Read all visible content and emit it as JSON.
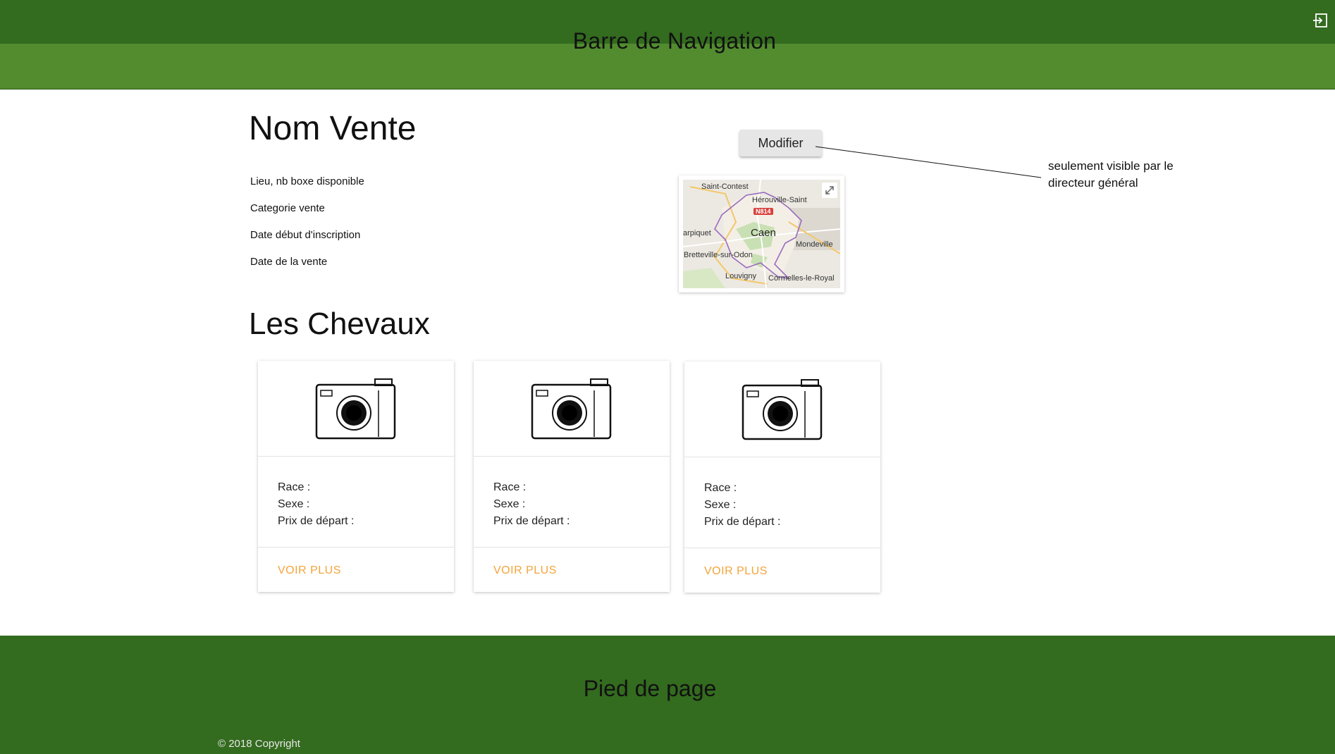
{
  "nav": {
    "title": "Barre de Navigation",
    "logout_icon": "logout-icon"
  },
  "sale": {
    "title": "Nom Vente",
    "info": [
      "Lieu, nb boxe disponible",
      "Categorie vente",
      "Date début d'inscription",
      "Date de la vente"
    ],
    "modify_label": "Modifier",
    "annotation": "seulement visible par le directeur général"
  },
  "map": {
    "labels": {
      "saint_contest": "Saint-Contest",
      "herouville": "Hérouville-Saint",
      "road": "N814",
      "carpiquet": "arpiquet",
      "caen": "Caen",
      "mondeville": "Mondeville",
      "bretteville": "Bretteville-sur-Odon",
      "louvigny": "Louvigny",
      "cormelles": "Cormelles-le-Royal"
    },
    "expand_icon": "expand-icon"
  },
  "horses": {
    "title": "Les Chevaux",
    "cards": [
      {
        "race": "Race :",
        "sexe": "Sexe :",
        "prix": "Prix de départ :",
        "action": "VOIR PLUS",
        "image_icon": "camera-icon"
      },
      {
        "race": "Race :",
        "sexe": "Sexe :",
        "prix": "Prix de départ :",
        "action": "VOIR PLUS",
        "image_icon": "camera-icon"
      },
      {
        "race": "Race :",
        "sexe": "Sexe :",
        "prix": "Prix de départ :",
        "action": "VOIR PLUS",
        "image_icon": "camera-icon"
      }
    ]
  },
  "footer": {
    "title": "Pied de page",
    "copyright": "© 2018 Copyright"
  },
  "colors": {
    "nav_dark": "#336b1f",
    "nav_light": "#528c2f",
    "footer": "#336b1f",
    "action": "#f4a43a",
    "button_bg": "#e6e6e6"
  }
}
